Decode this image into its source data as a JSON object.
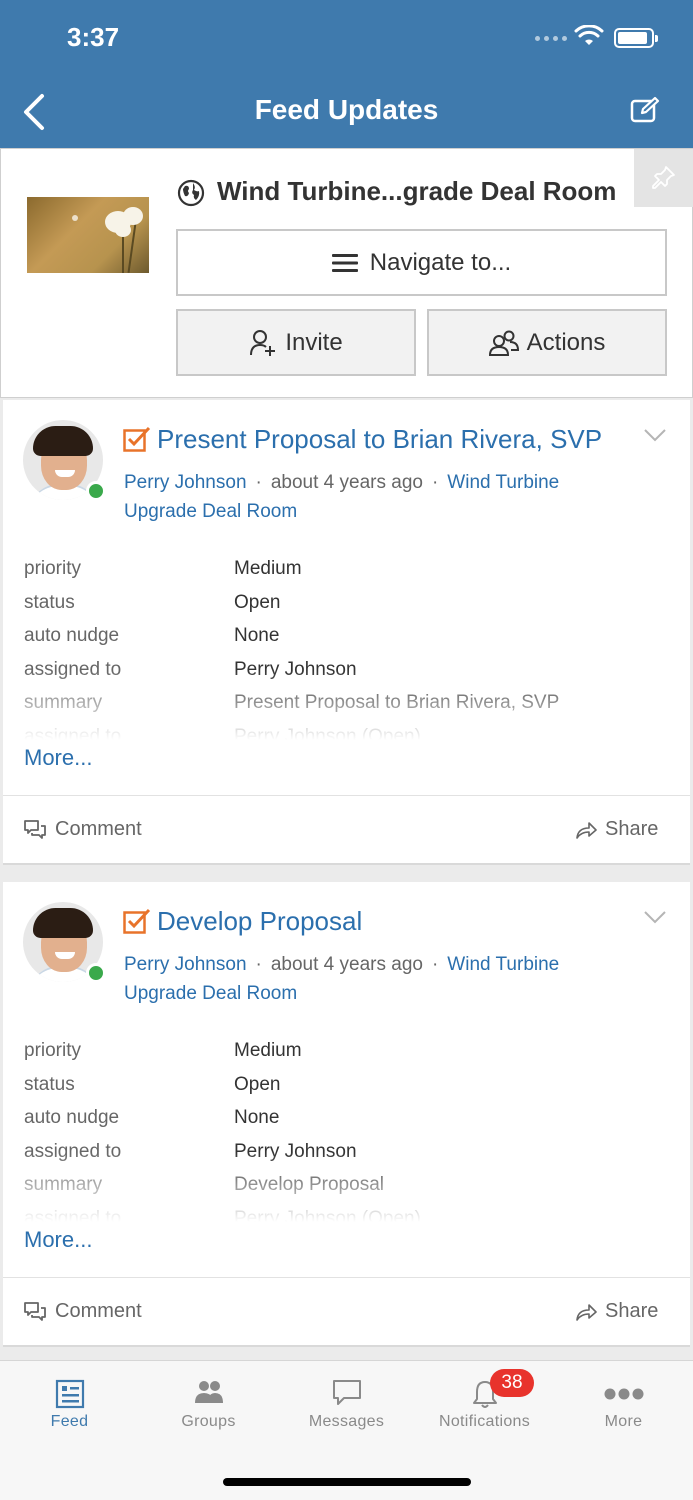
{
  "status_bar": {
    "time": "3:37"
  },
  "nav": {
    "title": "Feed Updates"
  },
  "room": {
    "title": "Wind Turbine...grade Deal Room",
    "navigate_label": "Navigate to...",
    "invite_label": "Invite",
    "actions_label": "Actions"
  },
  "feed": [
    {
      "title": "Present Proposal to Brian Rivera, SVP",
      "author": "Perry Johnson",
      "time": "about 4 years ago",
      "group": "Wind Turbine Upgrade Deal Room",
      "fields": [
        {
          "key": "priority",
          "value": "Medium"
        },
        {
          "key": "status",
          "value": "Open"
        },
        {
          "key": "auto nudge",
          "value": "None"
        },
        {
          "key": "assigned to",
          "value": "Perry Johnson"
        },
        {
          "key": "summary",
          "value": "Present Proposal to Brian Rivera, SVP"
        },
        {
          "key": "assigned to",
          "value": "Perry Johnson (Open)"
        }
      ],
      "more_label": "More...",
      "comment_label": "Comment",
      "share_label": "Share"
    },
    {
      "title": "Develop Proposal",
      "author": "Perry Johnson",
      "time": "about 4 years ago",
      "group": "Wind Turbine Upgrade Deal Room",
      "fields": [
        {
          "key": "priority",
          "value": "Medium"
        },
        {
          "key": "status",
          "value": "Open"
        },
        {
          "key": "auto nudge",
          "value": "None"
        },
        {
          "key": "assigned to",
          "value": "Perry Johnson"
        },
        {
          "key": "summary",
          "value": "Develop Proposal"
        },
        {
          "key": "assigned to",
          "value": "Perry Johnson (Open)"
        }
      ],
      "more_label": "More...",
      "comment_label": "Comment",
      "share_label": "Share"
    }
  ],
  "tabbar": {
    "items": [
      {
        "label": "Feed",
        "icon": "feed-icon",
        "active": true
      },
      {
        "label": "Groups",
        "icon": "groups-icon",
        "active": false
      },
      {
        "label": "Messages",
        "icon": "messages-icon",
        "active": false
      },
      {
        "label": "Notifications",
        "icon": "bell-icon",
        "active": false,
        "badge": "38"
      },
      {
        "label": "More",
        "icon": "more-dots-icon",
        "active": false
      }
    ]
  },
  "colors": {
    "nav_bar": "#3f7aad",
    "link": "#2b6fad",
    "task_icon": "#e8732a",
    "online": "#3aa94b",
    "badge": "#e8332c"
  }
}
